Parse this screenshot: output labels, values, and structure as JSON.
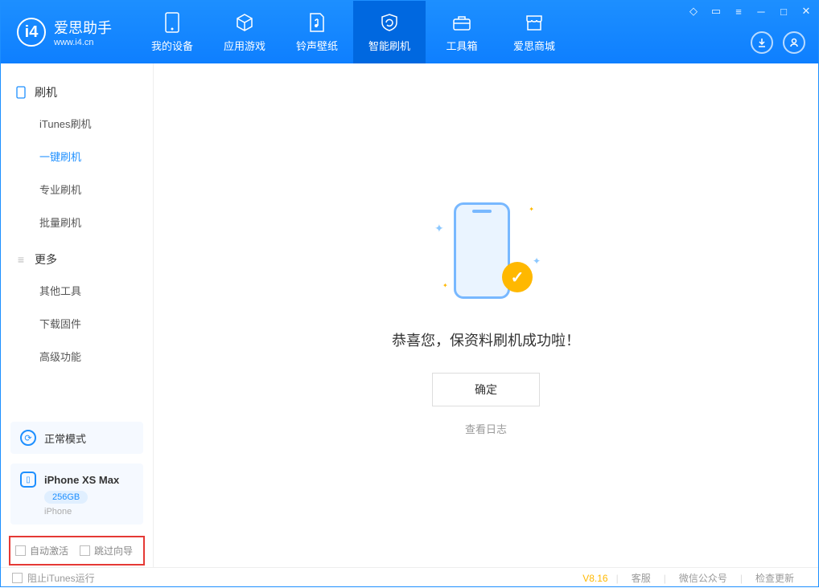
{
  "app": {
    "title": "爱思助手",
    "subtitle": "www.i4.cn"
  },
  "nav": {
    "tabs": [
      {
        "label": "我的设备"
      },
      {
        "label": "应用游戏"
      },
      {
        "label": "铃声壁纸"
      },
      {
        "label": "智能刷机"
      },
      {
        "label": "工具箱"
      },
      {
        "label": "爱思商城"
      }
    ]
  },
  "sidebar": {
    "section1": {
      "title": "刷机",
      "items": [
        "iTunes刷机",
        "一键刷机",
        "专业刷机",
        "批量刷机"
      ]
    },
    "section2": {
      "title": "更多",
      "items": [
        "其他工具",
        "下载固件",
        "高级功能"
      ]
    },
    "mode": {
      "label": "正常模式"
    },
    "device": {
      "name": "iPhone XS Max",
      "storage": "256GB",
      "type": "iPhone"
    },
    "checkboxes": {
      "auto_activate": "自动激活",
      "skip_wizard": "跳过向导"
    }
  },
  "main": {
    "success_message": "恭喜您，保资料刷机成功啦！",
    "ok_button": "确定",
    "view_log": "查看日志"
  },
  "footer": {
    "block_itunes": "阻止iTunes运行",
    "version": "V8.16",
    "links": [
      "客服",
      "微信公众号",
      "检查更新"
    ]
  }
}
